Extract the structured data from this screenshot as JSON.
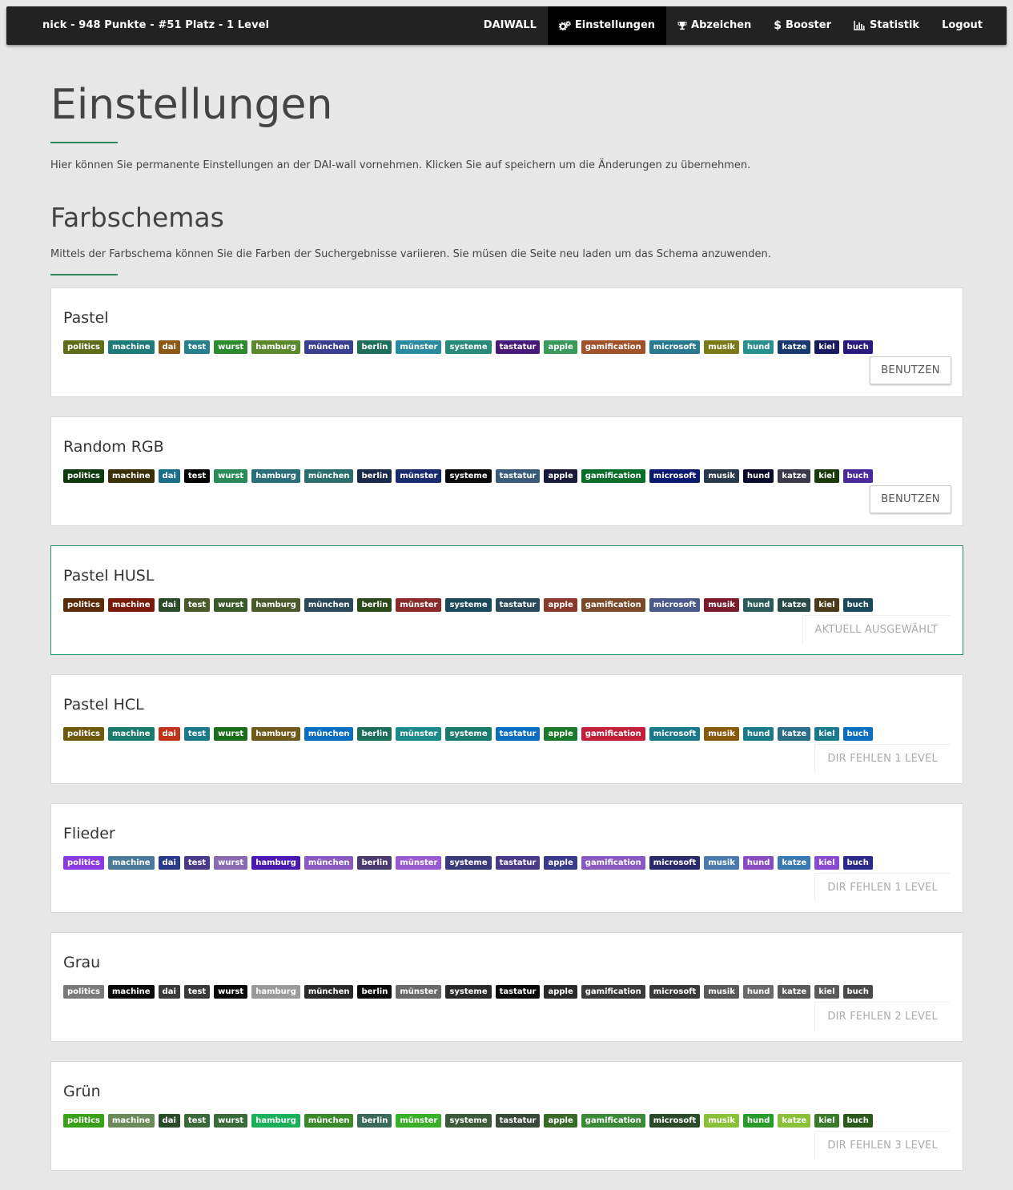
{
  "nav": {
    "brand": "nick - 948 Punkte - #51 Platz - 1 Level",
    "items": [
      {
        "label": "DAIWALL",
        "icon": "",
        "active": false
      },
      {
        "label": "Einstellungen",
        "icon": "cogs-icon",
        "active": true
      },
      {
        "label": "Abzeichen",
        "icon": "trophy-icon",
        "active": false
      },
      {
        "label": "Booster",
        "icon": "dollar-icon",
        "active": false
      },
      {
        "label": "Statistik",
        "icon": "bar-chart-icon",
        "active": false
      },
      {
        "label": "Logout",
        "icon": "",
        "active": false
      }
    ]
  },
  "page": {
    "title": "Einstellungen",
    "intro": "Hier können Sie permanente Einstellungen an der DAI-wall vornehmen. Klicken Sie auf speichern um die Änderungen zu übernehmen."
  },
  "schemes_section": {
    "title": "Farbschemas",
    "description": "Mittels der Farbschema können Sie die Farben der Suchergebnisse variieren. Sie müsen die Seite neu laden um das Schema anzuwenden."
  },
  "tag_labels": [
    "politics",
    "machine",
    "dai",
    "test",
    "wurst",
    "hamburg",
    "münchen",
    "berlin",
    "münster",
    "systeme",
    "tastatur",
    "apple",
    "gamification",
    "microsoft",
    "musik",
    "hund",
    "katze",
    "kiel",
    "buch"
  ],
  "schemes": [
    {
      "name": "Pastel",
      "action": "BENUTZEN",
      "action_type": "button",
      "selected": false,
      "colors": [
        "#5c6e1a",
        "#1f7a7a",
        "#8a5a16",
        "#2a7f8f",
        "#2e8a2e",
        "#5b8a2e",
        "#3a3f8f",
        "#1f6e5c",
        "#2a8a9f",
        "#2a8a7a",
        "#4a1a7a",
        "#3a9a5a",
        "#a0522d",
        "#2a7a8f",
        "#7a7a1a",
        "#2a8f8f",
        "#1a3a6e",
        "#1a1a5e",
        "#2a1a7e"
      ]
    },
    {
      "name": "Random RGB",
      "action": "BENUTZEN",
      "action_type": "button",
      "selected": false,
      "colors": [
        "#0e3a0e",
        "#3a3008",
        "#1a6e8a",
        "#000000",
        "#2a8a5a",
        "#2a6e7a",
        "#2a6e6e",
        "#1a2a4a",
        "#1a2a6e",
        "#0a0a0a",
        "#3a5a7a",
        "#1a1a3a",
        "#0a6e2a",
        "#0a1a6e",
        "#2a3a4a",
        "#0a0a2a",
        "#3a3a4a",
        "#1a3a0a",
        "#4a2a9a"
      ]
    },
    {
      "name": "Pastel HUSL",
      "action": "AKTUELL AUSGEWÄHLT",
      "action_type": "label",
      "selected": true,
      "colors": [
        "#5a2a0a",
        "#7a1a0a",
        "#2a4a2a",
        "#4a5a2a",
        "#3a5a2a",
        "#4a5a2a",
        "#2a4a5a",
        "#2a4a1a",
        "#8a2a2a",
        "#1a4a5a",
        "#2a4a5a",
        "#8a3a2a",
        "#7a4a2a",
        "#4a5a8a",
        "#7a1a2a",
        "#2a5a5a",
        "#2a4a4a",
        "#4a3a1a",
        "#1a4a5a"
      ]
    },
    {
      "name": "Pastel HCL",
      "action": "DIR FEHLEN 1 LEVEL",
      "action_type": "label",
      "selected": false,
      "colors": [
        "#6e5a0a",
        "#1a7a6e",
        "#c0321a",
        "#1a7a8a",
        "#1a6e1a",
        "#6e5a1a",
        "#0a6ec0",
        "#1a6e5a",
        "#1a8a8a",
        "#1a7a6e",
        "#0a6ec0",
        "#1a7a2a",
        "#c0203a",
        "#1a7a8a",
        "#8a5a0a",
        "#1a7a8a",
        "#2a6e8a",
        "#1a7a8a",
        "#0a6ec0"
      ]
    },
    {
      "name": "Flieder",
      "action": "DIR FEHLEN 1 LEVEL",
      "action_type": "label",
      "selected": false,
      "colors": [
        "#8a3ae0",
        "#4a7a9a",
        "#2a3a8a",
        "#4a3a8a",
        "#8a6ab0",
        "#4a1ab0",
        "#8a5ac0",
        "#4a3a6e",
        "#9a5ad0",
        "#3a3a7a",
        "#4a3a8a",
        "#3a3a8a",
        "#8a5ac0",
        "#2a2a6e",
        "#4a7ab0",
        "#8a4ac0",
        "#3a7ab0",
        "#8a4ad0",
        "#2a2a8a"
      ]
    },
    {
      "name": "Grau",
      "action": "DIR FEHLEN 2 LEVEL",
      "action_type": "label",
      "selected": false,
      "colors": [
        "#7a7a7a",
        "#0a0a0a",
        "#3a3a3a",
        "#3a3a3a",
        "#0a0a0a",
        "#9a9a9a",
        "#2a2a2a",
        "#0a0a0a",
        "#6a6a6a",
        "#2a2a2a",
        "#0a0a0a",
        "#2a2a2a",
        "#3a3a3a",
        "#3a3a3a",
        "#5a5a5a",
        "#6a6a6a",
        "#5a5a5a",
        "#5a5a5a",
        "#4a4a4a"
      ]
    },
    {
      "name": "Grün",
      "action": "DIR FEHLEN 3 LEVEL",
      "action_type": "label",
      "selected": false,
      "colors": [
        "#3aa01a",
        "#6a8a5a",
        "#2a4a2a",
        "#3a6a3a",
        "#3a6a3a",
        "#1ab05a",
        "#3a8a2a",
        "#3a6a5a",
        "#3ab02a",
        "#3a5a3a",
        "#3a4a3a",
        "#3a6a2a",
        "#3a8a3a",
        "#2a4a2a",
        "#8ac03a",
        "#2a9a2a",
        "#8ac03a",
        "#3a7a2a",
        "#2a5a1a"
      ]
    }
  ]
}
